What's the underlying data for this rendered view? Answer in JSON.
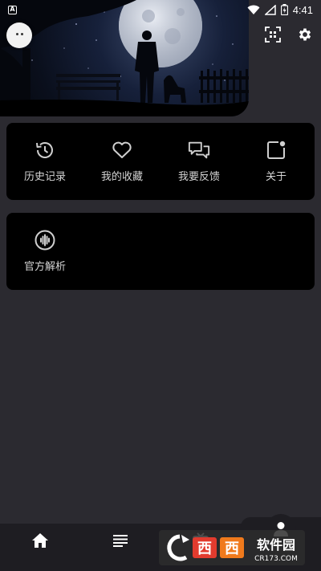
{
  "status_bar": {
    "time": "4:41",
    "notification_glyph": "A"
  },
  "header": {
    "scan_icon": "qr-scan-icon",
    "settings_icon": "gear-icon"
  },
  "menu_card": {
    "items": [
      {
        "label": "历史记录",
        "icon": "history-icon"
      },
      {
        "label": "我的收藏",
        "icon": "heart-icon"
      },
      {
        "label": "我要反馈",
        "icon": "chat-bubbles-icon"
      },
      {
        "label": "关于",
        "icon": "about-icon"
      }
    ]
  },
  "secondary_card": {
    "items": [
      {
        "label": "官方解析",
        "icon": "soundwave-icon"
      }
    ]
  },
  "bottom_nav": {
    "items": [
      {
        "icon": "home-icon"
      },
      {
        "icon": "list-icon"
      },
      {
        "icon": "video-icon"
      },
      {
        "icon": "profile-icon"
      }
    ]
  },
  "watermark": {
    "brand": "西西软件园",
    "domain": "CR173.COM"
  },
  "colors": {
    "background": "#2b2a30",
    "card": "#000000",
    "nav": "#1e1d22",
    "watermark_orange": "#f07a1c",
    "watermark_red": "#e23b2e"
  }
}
